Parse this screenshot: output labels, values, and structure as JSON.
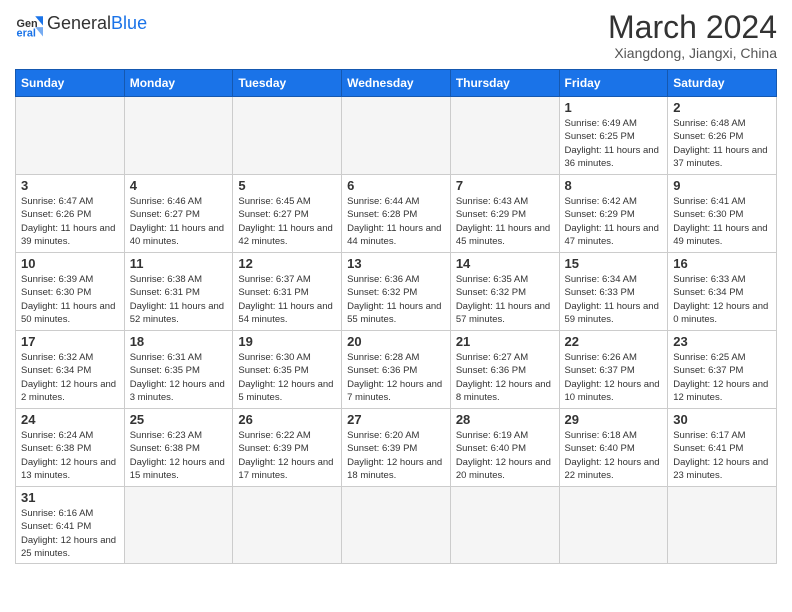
{
  "header": {
    "logo_general": "General",
    "logo_blue": "Blue",
    "month_year": "March 2024",
    "location": "Xiangdong, Jiangxi, China"
  },
  "weekdays": [
    "Sunday",
    "Monday",
    "Tuesday",
    "Wednesday",
    "Thursday",
    "Friday",
    "Saturday"
  ],
  "weeks": [
    [
      {
        "day": "",
        "info": ""
      },
      {
        "day": "",
        "info": ""
      },
      {
        "day": "",
        "info": ""
      },
      {
        "day": "",
        "info": ""
      },
      {
        "day": "",
        "info": ""
      },
      {
        "day": "1",
        "info": "Sunrise: 6:49 AM\nSunset: 6:25 PM\nDaylight: 11 hours and 36 minutes."
      },
      {
        "day": "2",
        "info": "Sunrise: 6:48 AM\nSunset: 6:26 PM\nDaylight: 11 hours and 37 minutes."
      }
    ],
    [
      {
        "day": "3",
        "info": "Sunrise: 6:47 AM\nSunset: 6:26 PM\nDaylight: 11 hours and 39 minutes."
      },
      {
        "day": "4",
        "info": "Sunrise: 6:46 AM\nSunset: 6:27 PM\nDaylight: 11 hours and 40 minutes."
      },
      {
        "day": "5",
        "info": "Sunrise: 6:45 AM\nSunset: 6:27 PM\nDaylight: 11 hours and 42 minutes."
      },
      {
        "day": "6",
        "info": "Sunrise: 6:44 AM\nSunset: 6:28 PM\nDaylight: 11 hours and 44 minutes."
      },
      {
        "day": "7",
        "info": "Sunrise: 6:43 AM\nSunset: 6:29 PM\nDaylight: 11 hours and 45 minutes."
      },
      {
        "day": "8",
        "info": "Sunrise: 6:42 AM\nSunset: 6:29 PM\nDaylight: 11 hours and 47 minutes."
      },
      {
        "day": "9",
        "info": "Sunrise: 6:41 AM\nSunset: 6:30 PM\nDaylight: 11 hours and 49 minutes."
      }
    ],
    [
      {
        "day": "10",
        "info": "Sunrise: 6:39 AM\nSunset: 6:30 PM\nDaylight: 11 hours and 50 minutes."
      },
      {
        "day": "11",
        "info": "Sunrise: 6:38 AM\nSunset: 6:31 PM\nDaylight: 11 hours and 52 minutes."
      },
      {
        "day": "12",
        "info": "Sunrise: 6:37 AM\nSunset: 6:31 PM\nDaylight: 11 hours and 54 minutes."
      },
      {
        "day": "13",
        "info": "Sunrise: 6:36 AM\nSunset: 6:32 PM\nDaylight: 11 hours and 55 minutes."
      },
      {
        "day": "14",
        "info": "Sunrise: 6:35 AM\nSunset: 6:32 PM\nDaylight: 11 hours and 57 minutes."
      },
      {
        "day": "15",
        "info": "Sunrise: 6:34 AM\nSunset: 6:33 PM\nDaylight: 11 hours and 59 minutes."
      },
      {
        "day": "16",
        "info": "Sunrise: 6:33 AM\nSunset: 6:34 PM\nDaylight: 12 hours and 0 minutes."
      }
    ],
    [
      {
        "day": "17",
        "info": "Sunrise: 6:32 AM\nSunset: 6:34 PM\nDaylight: 12 hours and 2 minutes."
      },
      {
        "day": "18",
        "info": "Sunrise: 6:31 AM\nSunset: 6:35 PM\nDaylight: 12 hours and 3 minutes."
      },
      {
        "day": "19",
        "info": "Sunrise: 6:30 AM\nSunset: 6:35 PM\nDaylight: 12 hours and 5 minutes."
      },
      {
        "day": "20",
        "info": "Sunrise: 6:28 AM\nSunset: 6:36 PM\nDaylight: 12 hours and 7 minutes."
      },
      {
        "day": "21",
        "info": "Sunrise: 6:27 AM\nSunset: 6:36 PM\nDaylight: 12 hours and 8 minutes."
      },
      {
        "day": "22",
        "info": "Sunrise: 6:26 AM\nSunset: 6:37 PM\nDaylight: 12 hours and 10 minutes."
      },
      {
        "day": "23",
        "info": "Sunrise: 6:25 AM\nSunset: 6:37 PM\nDaylight: 12 hours and 12 minutes."
      }
    ],
    [
      {
        "day": "24",
        "info": "Sunrise: 6:24 AM\nSunset: 6:38 PM\nDaylight: 12 hours and 13 minutes."
      },
      {
        "day": "25",
        "info": "Sunrise: 6:23 AM\nSunset: 6:38 PM\nDaylight: 12 hours and 15 minutes."
      },
      {
        "day": "26",
        "info": "Sunrise: 6:22 AM\nSunset: 6:39 PM\nDaylight: 12 hours and 17 minutes."
      },
      {
        "day": "27",
        "info": "Sunrise: 6:20 AM\nSunset: 6:39 PM\nDaylight: 12 hours and 18 minutes."
      },
      {
        "day": "28",
        "info": "Sunrise: 6:19 AM\nSunset: 6:40 PM\nDaylight: 12 hours and 20 minutes."
      },
      {
        "day": "29",
        "info": "Sunrise: 6:18 AM\nSunset: 6:40 PM\nDaylight: 12 hours and 22 minutes."
      },
      {
        "day": "30",
        "info": "Sunrise: 6:17 AM\nSunset: 6:41 PM\nDaylight: 12 hours and 23 minutes."
      }
    ],
    [
      {
        "day": "31",
        "info": "Sunrise: 6:16 AM\nSunset: 6:41 PM\nDaylight: 12 hours and 25 minutes."
      },
      {
        "day": "",
        "info": ""
      },
      {
        "day": "",
        "info": ""
      },
      {
        "day": "",
        "info": ""
      },
      {
        "day": "",
        "info": ""
      },
      {
        "day": "",
        "info": ""
      },
      {
        "day": "",
        "info": ""
      }
    ]
  ]
}
